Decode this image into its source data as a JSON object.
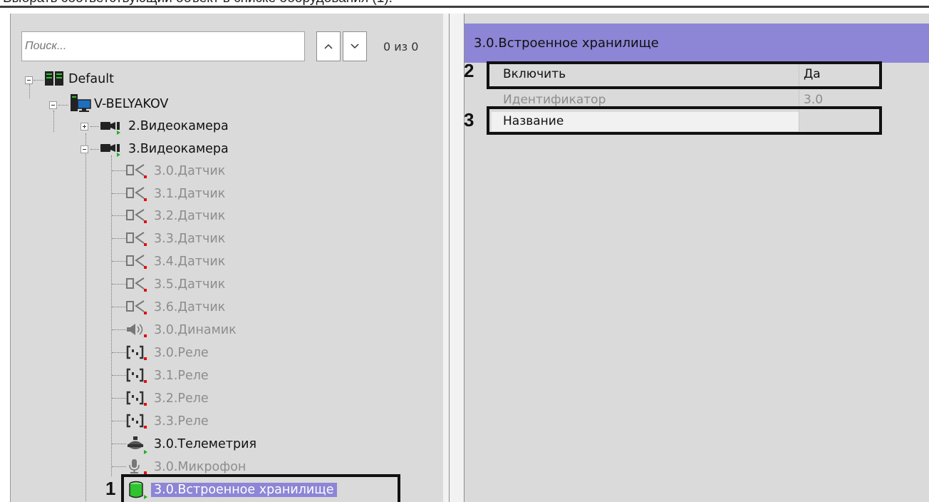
{
  "caption": "Выбрать соответствующий объект в списке оборудования (1).",
  "search": {
    "placeholder": "Поиск...",
    "counter": "0 из 0"
  },
  "tree": {
    "root": "Default",
    "server": "V-BELYAKOV",
    "camera2": "2.Видеокамера",
    "camera3": "3.Видеокамера",
    "children": [
      "3.0.Датчик",
      "3.1.Датчик",
      "3.2.Датчик",
      "3.3.Датчик",
      "3.4.Датчик",
      "3.5.Датчик",
      "3.6.Датчик",
      "3.0.Динамик",
      "3.0.Реле",
      "3.1.Реле",
      "3.2.Реле",
      "3.3.Реле",
      "3.0.Телеметрия",
      "3.0.Микрофон",
      "3.0.Встроенное хранилище"
    ]
  },
  "properties": {
    "title": "3.0.Встроенное хранилище",
    "rows": [
      {
        "name": "Включить",
        "value": "Да"
      },
      {
        "name": "Идентификатор",
        "value": "3.0"
      },
      {
        "name": "Название",
        "value": ""
      }
    ]
  },
  "annotations": [
    "1",
    "2",
    "3"
  ],
  "colors": {
    "selection": "#8d86d6",
    "panel": "#dadada",
    "annotation": "#111111"
  }
}
